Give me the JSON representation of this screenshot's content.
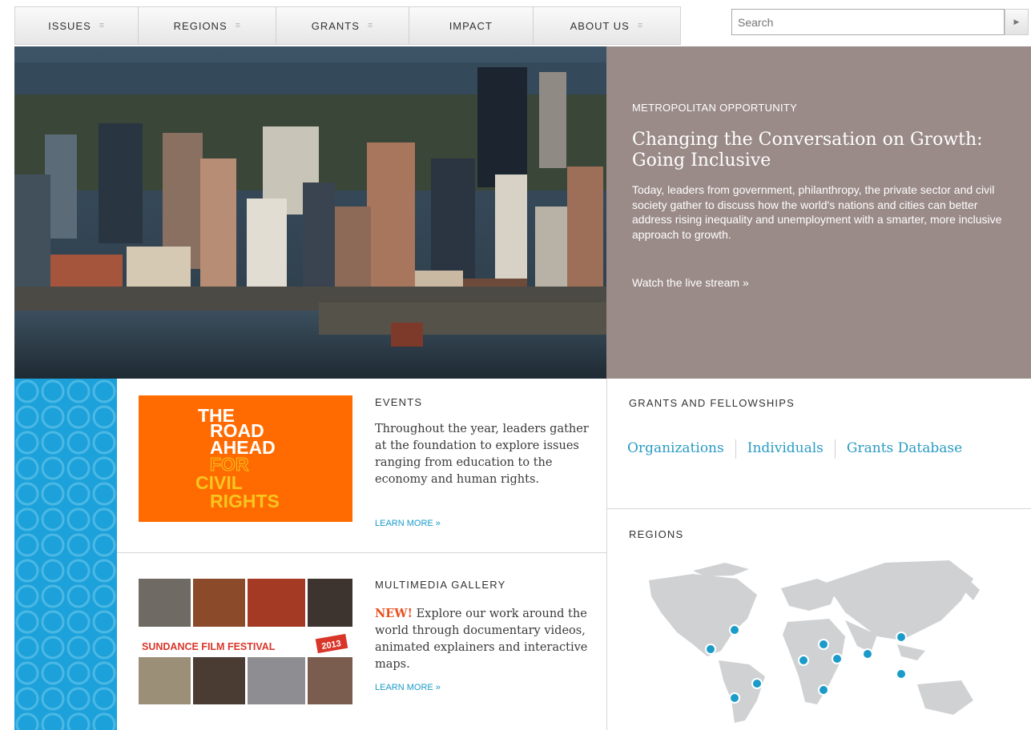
{
  "nav": {
    "items": [
      {
        "label": "ISSUES",
        "has_menu": true
      },
      {
        "label": "REGIONS",
        "has_menu": true
      },
      {
        "label": "GRANTS",
        "has_menu": true
      },
      {
        "label": "IMPACT",
        "has_menu": false
      },
      {
        "label": "ABOUT US",
        "has_menu": true
      }
    ],
    "menu_glyph": "≡"
  },
  "search": {
    "placeholder": "Search",
    "go_icon": "triangle-right-icon"
  },
  "hero": {
    "kicker": "METROPOLITAN OPPORTUNITY",
    "title": "Changing the Conversation on Growth: Going Inclusive",
    "body": "Today, leaders from government, philanthropy, the private sector and civil society gather to discuss how the world's nations and cities can better address rising inequality and unemployment with a smarter, more inclusive approach to growth.",
    "link": "Watch the live stream »"
  },
  "events": {
    "label": "EVENTS",
    "body": "Throughout the year, leaders gather at the foundation to explore issues ranging from education to the economy and human rights.",
    "link": "LEARN MORE »",
    "thumb_lines": [
      "THE",
      "ROAD",
      "AHEAD",
      "FOR",
      "CIVIL",
      "RIGHTS"
    ]
  },
  "multimedia": {
    "label": "MULTIMEDIA GALLERY",
    "new_tag": "NEW!",
    "body": "Explore our work around the world through documentary videos, animated explainers and interactive maps.",
    "link": "LEARN MORE »",
    "banner": "SUNDANCE FILM FESTIVAL",
    "banner_year": "2013"
  },
  "grants": {
    "label": "GRANTS AND FELLOWSHIPS",
    "links": [
      "Organizations",
      "Individuals",
      "Grants Database"
    ]
  },
  "regions": {
    "label": "REGIONS"
  },
  "colors": {
    "accent_blue": "#1da1da",
    "link_blue": "#2a9bc4",
    "hero_panel": "#9a8b88",
    "events_orange": "#ff6b00",
    "new_red": "#e8501f"
  }
}
